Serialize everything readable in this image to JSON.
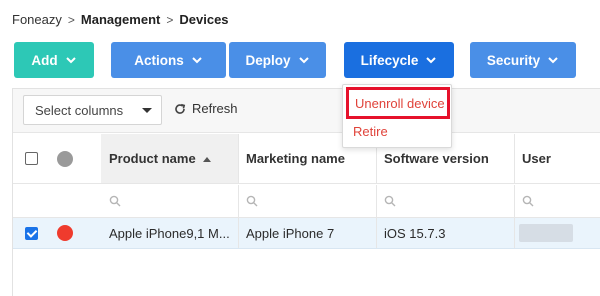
{
  "breadcrumb": {
    "root": "Foneazy",
    "sep1": ">",
    "management": "Management",
    "sep2": ">",
    "devices": "Devices"
  },
  "toolbar": {
    "add": "Add",
    "actions": "Actions",
    "deploy": "Deploy",
    "lifecycle": "Lifecycle",
    "security": "Security"
  },
  "lifecycle_menu": {
    "items": [
      "Unenroll device",
      "Retire"
    ],
    "highlighted": "Unenroll device"
  },
  "grid": {
    "select_columns": {
      "placeholder": "Select columns"
    },
    "refresh": "Refresh",
    "columns": [
      "Product name",
      "Marketing name",
      "Software version",
      "User"
    ],
    "sorted_column": "Product name",
    "sort_direction": "ascending",
    "rows": [
      {
        "selected": true,
        "status_color": "#ef3b2d",
        "product_name": "Apple iPhone9,1 M...",
        "marketing_name": "Apple iPhone 7",
        "software_version": "iOS 15.7.3",
        "user": ""
      }
    ]
  },
  "colors": {
    "add_button": "#2dc8b6",
    "action_buttons": "#4a8fe7",
    "lifecycle_active": "#1a6fe0",
    "menu_text": "#e0433a",
    "highlight_border": "#e6112b",
    "selected_row": "#eaf4fc"
  },
  "icons": {
    "button_chevron": "chevron-down-icon",
    "refresh": "refresh-icon",
    "filter": "search-icon",
    "sort": "sort-ascending-icon"
  }
}
